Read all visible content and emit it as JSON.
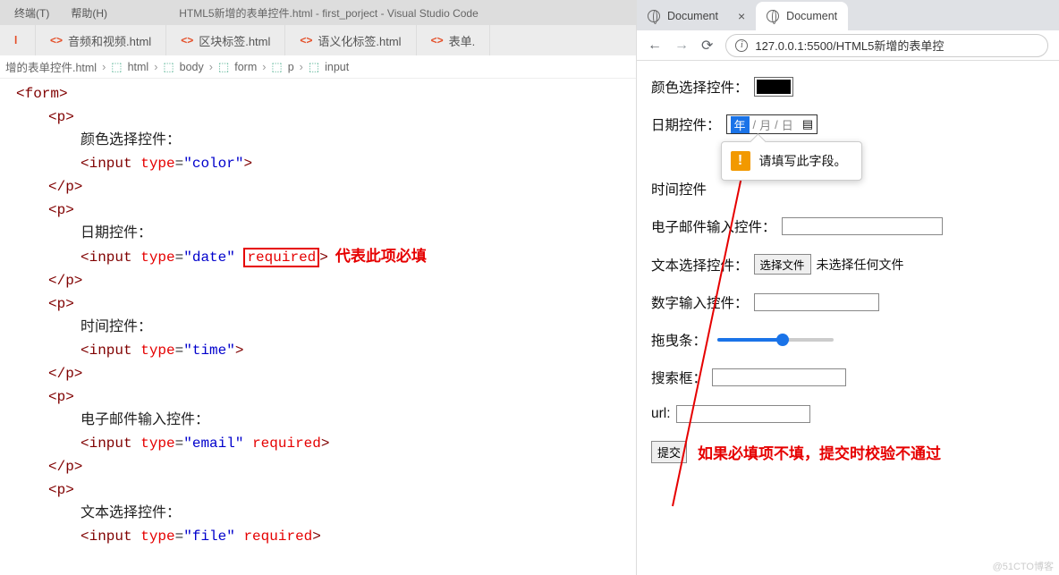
{
  "vscode": {
    "menu": {
      "terminal": "终端(T)",
      "help": "帮助(H)"
    },
    "title": "HTML5新增的表单控件.html - first_porject - Visual Studio Code",
    "tabs": [
      {
        "label": "音频和视频.html"
      },
      {
        "label": "区块标签.html"
      },
      {
        "label": "语义化标签.html"
      },
      {
        "label": "表单."
      }
    ],
    "breadcrumbs": {
      "file": "增的表单控件.html",
      "parts": [
        "html",
        "body",
        "form",
        "p",
        "input"
      ]
    },
    "code": {
      "form_open": "<form>",
      "p_open": "<p>",
      "p_close": "</p>",
      "color_label": "颜色选择控件：",
      "color_line": {
        "type_attr": "type",
        "type_val": "\"color\""
      },
      "date_label": "日期控件：",
      "date_line": {
        "type_attr": "type",
        "type_val": "\"date\"",
        "required": "required"
      },
      "time_label": "时间控件：",
      "time_line": {
        "type_attr": "type",
        "type_val": "\"time\""
      },
      "email_label": "电子邮件输入控件：",
      "email_line": {
        "type_attr": "type",
        "type_val": "\"email\"",
        "required": "required"
      },
      "file_label": "文本选择控件：",
      "file_line": {
        "type_attr": "type",
        "type_val": "\"file\"",
        "required": "required"
      }
    },
    "annotations": {
      "required_note": "代表此项必填"
    }
  },
  "browser": {
    "tabs": {
      "inactive": "Document",
      "active": "Document"
    },
    "url": "127.0.0.1:5500/HTML5新增的表单控",
    "form": {
      "color_label": "颜色选择控件：",
      "date_label": "日期控件：",
      "date_placeholder": {
        "year": "年",
        "month": "月",
        "day": "日"
      },
      "tooltip": "请填写此字段。",
      "time_label": "时间控件",
      "email_label": "电子邮件输入控件：",
      "file_label": "文本选择控件：",
      "file_button": "选择文件",
      "file_status": "未选择任何文件",
      "number_label": "数字输入控件：",
      "range_label": "拖曳条：",
      "search_label": "搜索框：",
      "url_label": "url:",
      "submit": "提交"
    },
    "annotations": {
      "bottom_note": "如果必填项不填，提交时校验不通过"
    }
  },
  "watermark": "@51CTO博客"
}
